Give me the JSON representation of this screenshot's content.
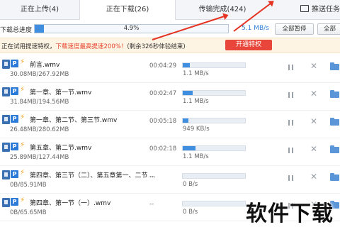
{
  "tabs": {
    "upload": "正在上传(4)",
    "downloading": "正在下载(26)",
    "done": "传输完成(424)",
    "push": "推送任务"
  },
  "progress": {
    "label": "下载总进度",
    "percent_text": "4.9%",
    "percent_value": 4.9,
    "speed": "5.1 MB/s",
    "pause_all": "全部暂停",
    "more": "全部"
  },
  "trial": {
    "prefix": "正在试用提速特权，",
    "highlight": "下载速度最高提速200%！",
    "suffix": "(剩余326秒体验结束)",
    "button": "开通特权"
  },
  "files": [
    {
      "name": "前言.wmv",
      "size": "30.08MB/267.92MB",
      "time": "00:04:29",
      "speed": "1.1 MB/s",
      "progress": 0.11
    },
    {
      "name": "第一章、第一节.wmv",
      "size": "31.84MB/194.56MB",
      "time": "00:02:47",
      "speed": "1.1 MB/s",
      "progress": 0.16
    },
    {
      "name": "第一章、第二节、第三节.wmv",
      "size": "26.48MB/280.62MB",
      "time": "00:05:18",
      "speed": "949 KB/s",
      "progress": 0.09
    },
    {
      "name": "第五章、第二节.wmv",
      "size": "25.89MB/127.44MB",
      "time": "00:02:18",
      "speed": "1.1 MB/s",
      "progress": 0.2
    },
    {
      "name": "第四章、第三节（二）、第五章第一、二节 ...",
      "size": "0B/85.91MB",
      "time": "--",
      "speed": "0 B/s",
      "progress": 0
    },
    {
      "name": "第四章、第一节（一）.wmv",
      "size": "0B/65.65MB",
      "time": "--",
      "speed": "0 B/s",
      "progress": 0
    }
  ],
  "watermark": "软件下载",
  "colors": {
    "accent": "#3f8ee0",
    "warning": "#e6452e",
    "vip_button": "#e8463a"
  }
}
